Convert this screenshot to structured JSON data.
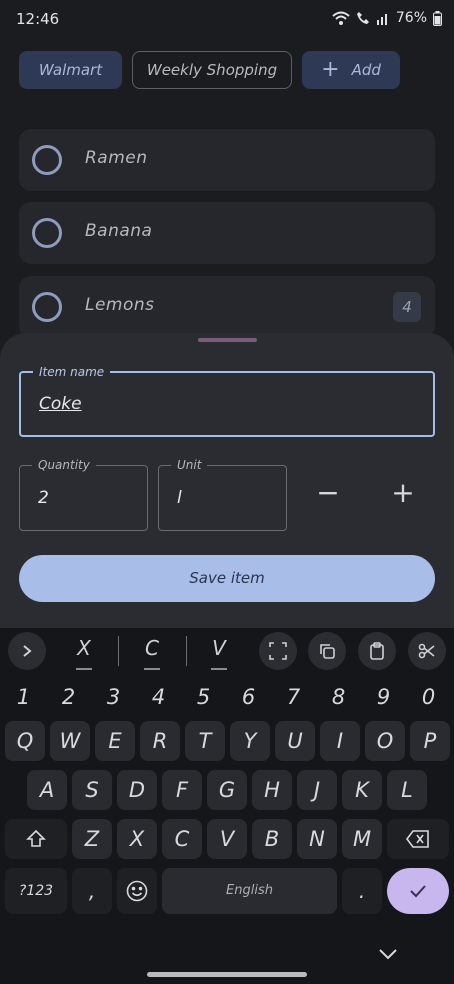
{
  "status": {
    "time": "12:46",
    "battery": "76%"
  },
  "chips": {
    "store": "Walmart",
    "list": "Weekly Shopping",
    "add": "Add",
    "add_icon": "+"
  },
  "items": [
    {
      "label": "Ramen"
    },
    {
      "label": "Banana"
    },
    {
      "label": "Lemons",
      "quantity": "4"
    }
  ],
  "form": {
    "item_name_label": "Item name",
    "item_name_value": "Coke",
    "quantity_label": "Quantity",
    "quantity_value": "2",
    "unit_label": "Unit",
    "unit_value": "l",
    "decrement": "−",
    "increment": "+",
    "save_label": "Save item"
  },
  "keyboard": {
    "suggestions": [
      "X",
      "C",
      "V"
    ],
    "digits": [
      "1",
      "2",
      "3",
      "4",
      "5",
      "6",
      "7",
      "8",
      "9",
      "0"
    ],
    "row1": [
      "Q",
      "W",
      "E",
      "R",
      "T",
      "Y",
      "U",
      "I",
      "O",
      "P"
    ],
    "row2": [
      "A",
      "S",
      "D",
      "F",
      "G",
      "H",
      "J",
      "K",
      "L"
    ],
    "row3": [
      "Z",
      "X",
      "C",
      "V",
      "B",
      "N",
      "M"
    ],
    "symbols": "?123",
    "comma": ",",
    "period": ".",
    "space": "English"
  }
}
